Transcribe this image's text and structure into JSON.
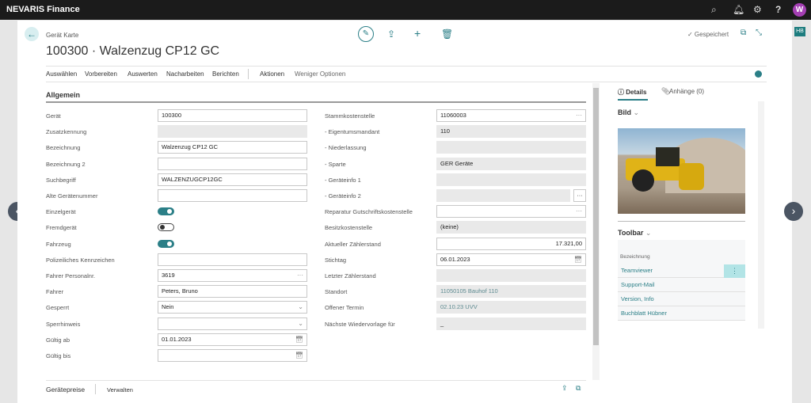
{
  "app": {
    "title": "NEVARIS Finance",
    "avatar": "W",
    "user_badge": "HB"
  },
  "header": {
    "breadcrumb": "Gerät Karte",
    "title": "100300 · Walzenzug CP12 GC",
    "saved_status": "✓ Gespeichert"
  },
  "actions": [
    "Auswählen",
    "Vorbereiten",
    "Auswerten",
    "Nacharbeiten",
    "Berichten",
    "Aktionen",
    "Weniger Optionen"
  ],
  "section": {
    "title": "Allgemein"
  },
  "left_fields": [
    {
      "label": "Gerät",
      "value": "100300",
      "type": "text"
    },
    {
      "label": "Zusatzkennung",
      "value": "",
      "type": "readonly"
    },
    {
      "label": "Bezeichnung",
      "value": "Walzenzug CP12 GC",
      "type": "text"
    },
    {
      "label": "Bezeichnung 2",
      "value": "",
      "type": "text"
    },
    {
      "label": "Suchbegriff",
      "value": "WALZENZUGCP12GC",
      "type": "text"
    },
    {
      "label": "Alte Gerätenummer",
      "value": "",
      "type": "text"
    },
    {
      "label": "Einzelgerät",
      "value": true,
      "type": "toggle"
    },
    {
      "label": "Fremdgerät",
      "value": false,
      "type": "toggle"
    },
    {
      "label": "Fahrzeug",
      "value": true,
      "type": "toggle"
    },
    {
      "label": "Polizeiliches Kennzeichen",
      "value": "",
      "type": "text"
    },
    {
      "label": "Fahrer Personalnr.",
      "value": "3619",
      "type": "lookup"
    },
    {
      "label": "Fahrer",
      "value": "Peters, Bruno",
      "type": "text"
    },
    {
      "label": "Gesperrt",
      "value": "Nein",
      "type": "select"
    },
    {
      "label": "Sperrhinweis",
      "value": "",
      "type": "select"
    },
    {
      "label": "Gültig ab",
      "value": "01.01.2023",
      "type": "date"
    },
    {
      "label": "Gültig bis",
      "value": "",
      "type": "date"
    }
  ],
  "right_fields": [
    {
      "label": "Stammkostenstelle",
      "value": "11060003",
      "type": "lookup"
    },
    {
      "label": "- Eigentumsmandant",
      "value": "110",
      "type": "readonly"
    },
    {
      "label": "- Niederlassung",
      "value": "",
      "type": "readonly"
    },
    {
      "label": "- Sparte",
      "value": "GER Geräte",
      "type": "readonly"
    },
    {
      "label": "- Geräteinfo 1",
      "value": "",
      "type": "readonly"
    },
    {
      "label": "- Geräteinfo 2",
      "value": "",
      "type": "readonly-btn"
    },
    {
      "label": "Reparatur Gutschriftskostenstelle",
      "value": "",
      "type": "lookup"
    },
    {
      "label": "Besitzkostenstelle",
      "value": "(keine)",
      "type": "readonly"
    },
    {
      "label": "Aktueller Zählerstand",
      "value": "17.321,00",
      "type": "number"
    },
    {
      "label": "Stichtag",
      "value": "06.01.2023",
      "type": "date"
    },
    {
      "label": "Letzter Zählerstand",
      "value": "",
      "type": "readonly"
    },
    {
      "label": "Standort",
      "value": "11050105 Bauhof 110",
      "type": "readonly-link"
    },
    {
      "label": "Offener Termin",
      "value": "02.10.23 UVV",
      "type": "readonly-link"
    },
    {
      "label": "Nächste Wiedervorlage für",
      "value": "_",
      "type": "readonly"
    }
  ],
  "subpage": {
    "title": "Gerätepreise",
    "action": "Verwalten"
  },
  "factbox": {
    "tabs": [
      "ⓘ Details",
      "Anhänge (0)"
    ],
    "bild_title": "Bild",
    "toolbar_title": "Toolbar",
    "toolbar_header": "Bezeichnung",
    "toolbar_items": [
      "Teamviewer",
      "Support-Mail",
      "Version, Info",
      "Buchblatt Hübner"
    ]
  },
  "colors": {
    "accent": "#2b7f87",
    "topbar": "#1b1b1b"
  }
}
